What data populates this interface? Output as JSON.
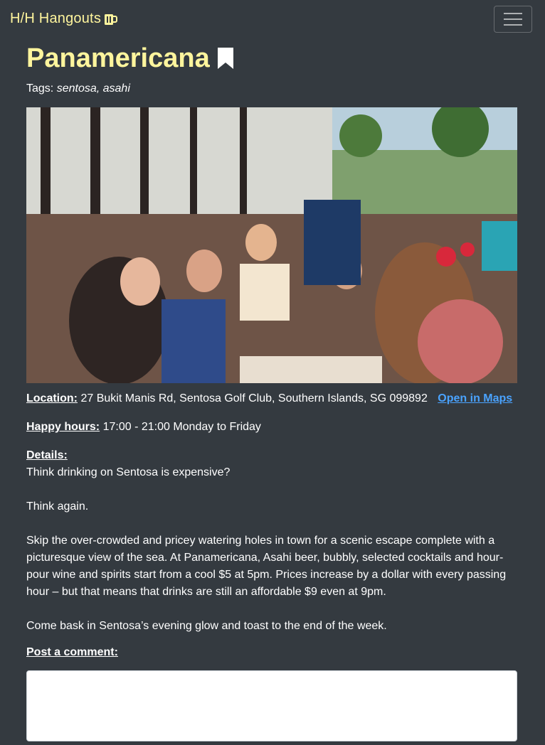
{
  "navbar": {
    "brand": "H/H Hangouts",
    "brand_icon": "beer-mug-icon",
    "toggler_icon": "hamburger-menu-icon"
  },
  "venue": {
    "name": "Panamericana",
    "bookmark_icon": "bookmark-icon",
    "tags_label": "Tags:",
    "tags": "sentosa, asahi",
    "photo_alt": "Panamericana"
  },
  "location": {
    "label": "Location:",
    "address": "27 Bukit Manis Rd, Sentosa Golf Club, Southern Islands, SG 099892",
    "maps_link": "Open in Maps"
  },
  "happy_hours": {
    "label": "Happy hours:",
    "value": "17:00 - 21:00 Monday to Friday"
  },
  "details": {
    "label": "Details:",
    "paragraphs": [
      "Think drinking on Sentosa is expensive?",
      "Think again.",
      "Skip the over-crowded and pricey watering holes in town for a scenic escape complete with a picturesque view of the sea. At Panamericana, Asahi beer, bubbly, selected cocktails and hour-pour wine and spirits start from a cool $5 at 5pm. Prices increase by a dollar with every passing hour – but that means that drinks are still an affordable $9 even at 9pm.",
      "Come bask in Sentosa’s evening glow and toast to the end of the week."
    ]
  },
  "comment": {
    "label": "Post a comment:"
  },
  "colors": {
    "background": "#343a40",
    "accent": "#fff59d",
    "link": "#4aa3ff"
  }
}
